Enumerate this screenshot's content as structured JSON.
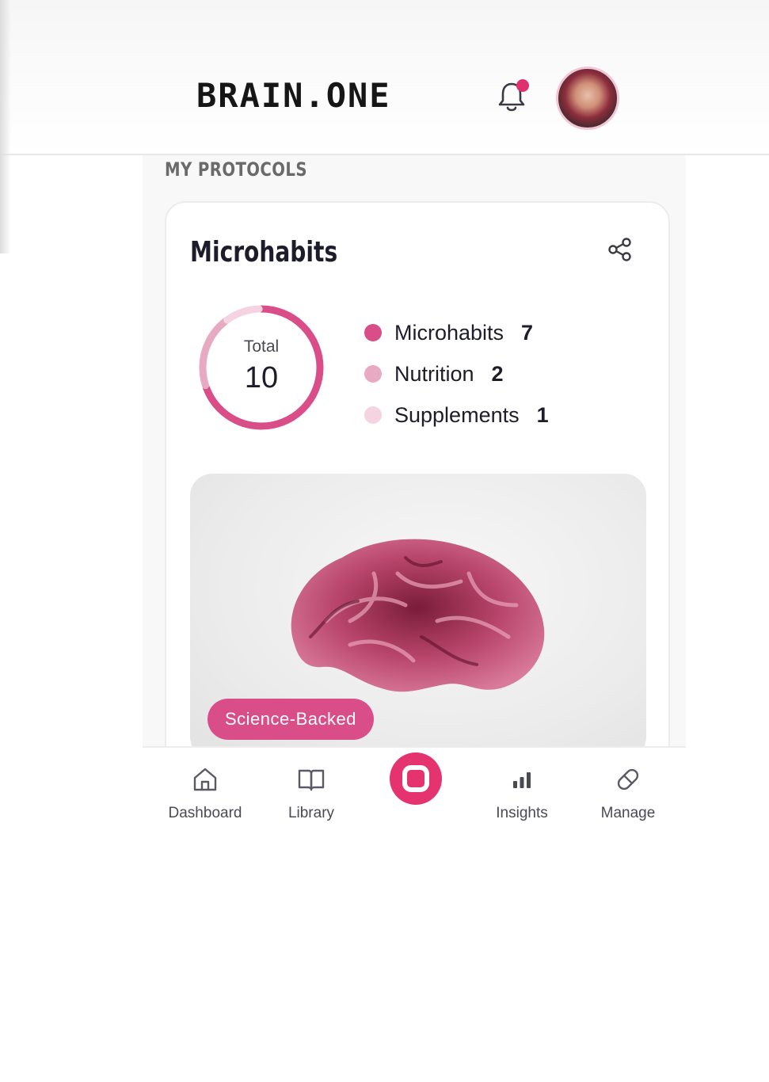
{
  "header": {
    "logo": "BRAIN.ONE",
    "notification_icon": "bell-icon",
    "has_notification": true,
    "accent_color": "#e0316f"
  },
  "section": {
    "title": "MY PROTOCOLS"
  },
  "card": {
    "title": "Microhabits",
    "share_icon": "share-icon",
    "donut": {
      "label": "Total",
      "value": "10"
    },
    "legend": [
      {
        "label": "Microhabits",
        "count": "7",
        "color": "#d94d88"
      },
      {
        "label": "Nutrition",
        "count": "2",
        "color": "#e8a9c3"
      },
      {
        "label": "Supplements",
        "count": "1",
        "color": "#f5d3e0"
      }
    ],
    "badge": "Science-Backed"
  },
  "nav": {
    "items": [
      {
        "label": "Dashboard",
        "icon": "home-icon"
      },
      {
        "label": "Library",
        "icon": "book-icon"
      },
      {
        "label": "Insights",
        "icon": "bar-chart-icon"
      },
      {
        "label": "Manage",
        "icon": "pill-icon"
      }
    ],
    "center_icon": "record-icon"
  }
}
